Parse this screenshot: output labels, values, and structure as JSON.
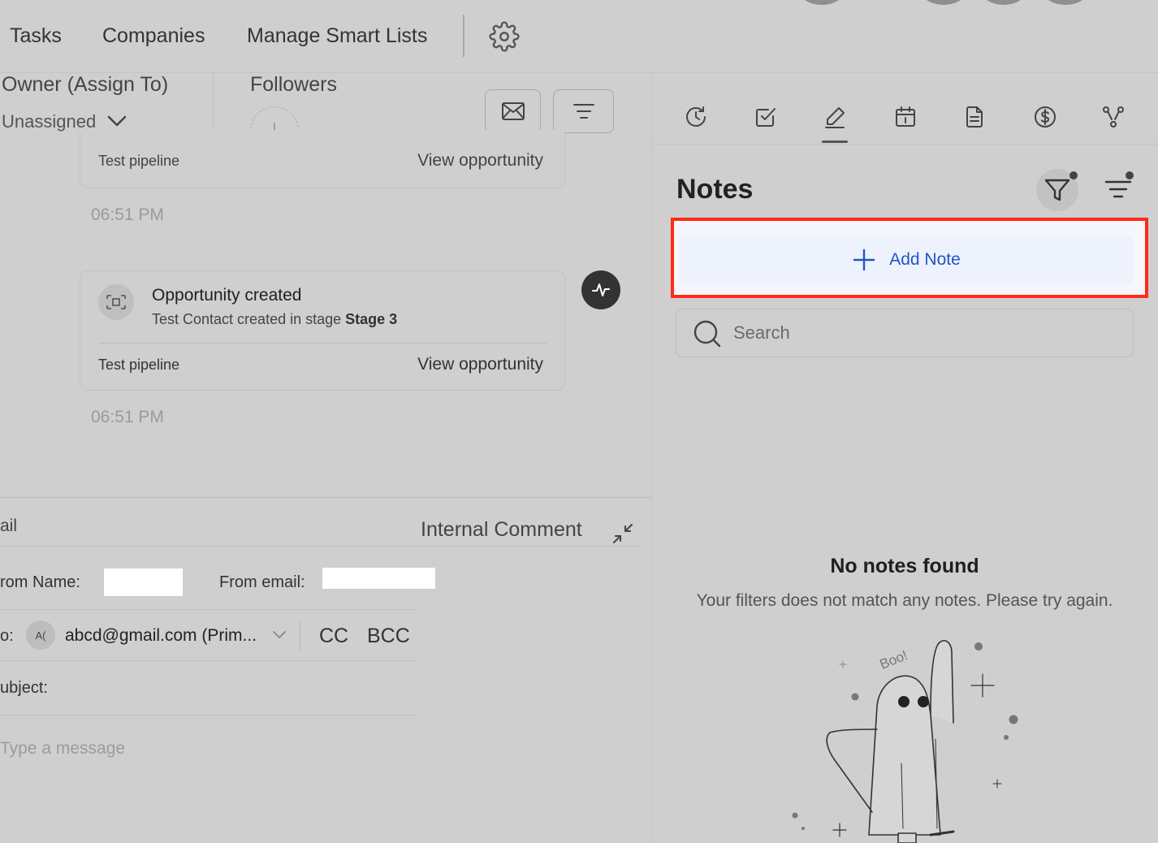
{
  "topnav": {
    "items": [
      "Tasks",
      "Companies",
      "Manage Smart Lists"
    ]
  },
  "contact_header": {
    "owner_label": "Owner (Assign To)",
    "owner_value": "Unassigned",
    "followers_label": "Followers"
  },
  "timeline": {
    "partial_card": {
      "pipeline": "Test pipeline",
      "link": "View opportunity"
    },
    "time_1": "06:51 PM",
    "card": {
      "title": "Opportunity created",
      "subtitle_prefix": "Test Contact created in stage ",
      "subtitle_stage": "Stage 3",
      "pipeline": "Test pipeline",
      "link": "View opportunity"
    },
    "time_2": "06:51 PM"
  },
  "composer": {
    "tab_label": "ail",
    "internal_comment": "Internal Comment",
    "from_name_label": "rom Name:",
    "from_email_label": "From email:",
    "to_label": "o:",
    "to_avatar": "A(",
    "to_value": "abcd@gmail.com (Prim...",
    "cc": "CC",
    "bcc": "BCC",
    "subject_label": "ubject:",
    "message_placeholder": "Type a message"
  },
  "notes_panel": {
    "tabs": [
      "activity-icon",
      "task-icon",
      "note-icon",
      "calendar-icon",
      "document-icon",
      "payment-icon",
      "workflow-icon"
    ],
    "active_tab": 2,
    "title": "Notes",
    "add_note": "Add Note",
    "search_placeholder": "Search",
    "empty_title": "No notes found",
    "empty_subtitle": "Your filters does not match any notes. Please try again.",
    "illustration_text": "Boo!"
  },
  "colors": {
    "highlight": "#ff2a1a",
    "primary": "#1f56c9",
    "background": "#cfcfcf"
  }
}
